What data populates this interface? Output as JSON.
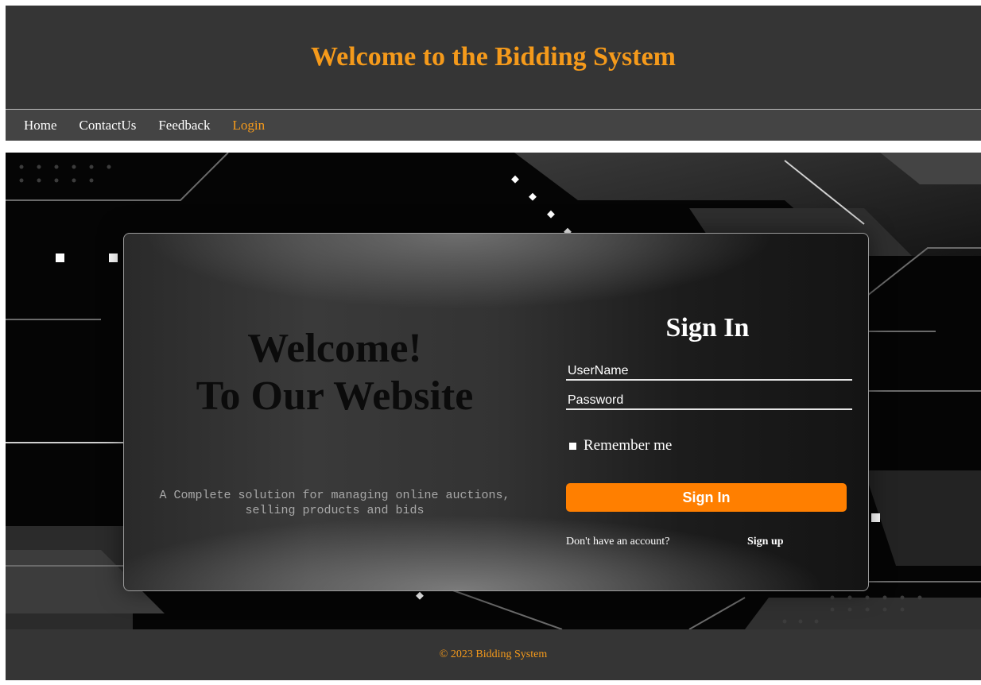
{
  "header": {
    "title": "Welcome to the Bidding System"
  },
  "nav": {
    "items": [
      {
        "label": "Home",
        "active": false
      },
      {
        "label": "ContactUs",
        "active": false
      },
      {
        "label": "Feedback",
        "active": false
      },
      {
        "label": "Login",
        "active": true
      }
    ]
  },
  "hero": {
    "welcome_line1": "Welcome!",
    "welcome_line2": "To Our Website",
    "tagline_line1": "A Complete solution for managing online auctions,",
    "tagline_line2": "selling products and bids"
  },
  "login": {
    "title": "Sign In",
    "username_placeholder": "UserName",
    "password_placeholder": "Password",
    "remember_label": "Remember me",
    "submit_label": "Sign In",
    "no_account_text": "Don't have an account?",
    "signup_label": "Sign up"
  },
  "footer": {
    "text": "© 2023 Bidding System"
  },
  "colors": {
    "accent": "#f59a1b",
    "button": "#ff7f00",
    "bar": "#353535",
    "nav": "#444444"
  }
}
